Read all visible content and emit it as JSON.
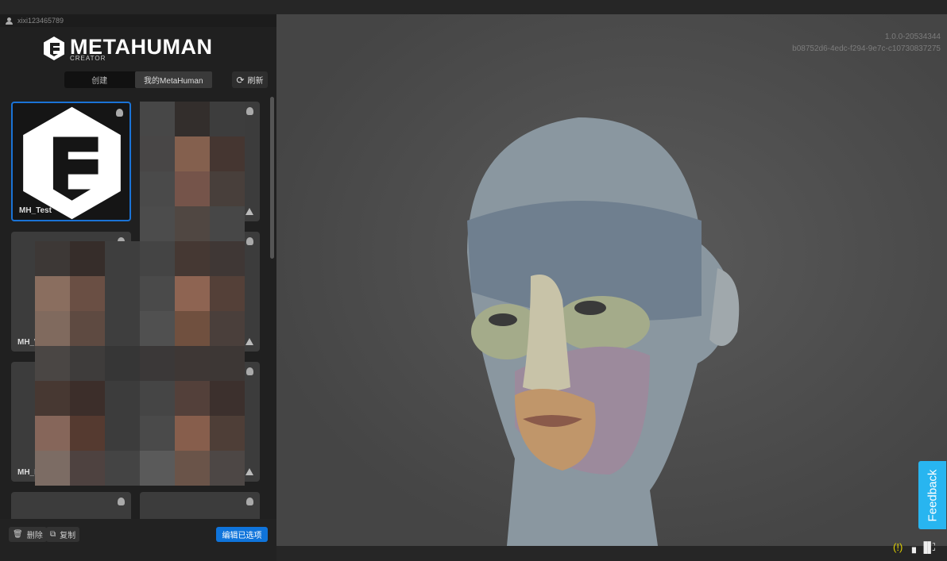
{
  "user": {
    "name": "xixi123465789"
  },
  "brand": {
    "title": "METAHUMAN",
    "subtitle": "CREATOR"
  },
  "tabs": [
    {
      "label": "创建",
      "active": false
    },
    {
      "label": "我的MetaHuman",
      "active": true
    }
  ],
  "refresh_label": "刷新",
  "cards": [
    {
      "name": "MH_Test",
      "selected": true
    },
    {
      "name": "",
      "selected": false
    },
    {
      "name": "MH_W",
      "selected": false
    },
    {
      "name": "",
      "selected": false
    },
    {
      "name": "MH_M",
      "selected": false
    },
    {
      "name": "",
      "selected": false
    },
    {
      "name": "",
      "selected": false
    },
    {
      "name": "",
      "selected": false
    }
  ],
  "footer": {
    "delete_label": "删除",
    "copy_label": "复制",
    "edit_label": "编辑已选项"
  },
  "viewport": {
    "version": "1.0.0-20534344",
    "build_id": "b08752d6-4edc-f294-9e7c-c10730837275"
  },
  "feedback_label": "Feedback",
  "colors": {
    "accent": "#0f74db",
    "feedback": "#28b5f0",
    "warning_icon": "#e0d000"
  }
}
